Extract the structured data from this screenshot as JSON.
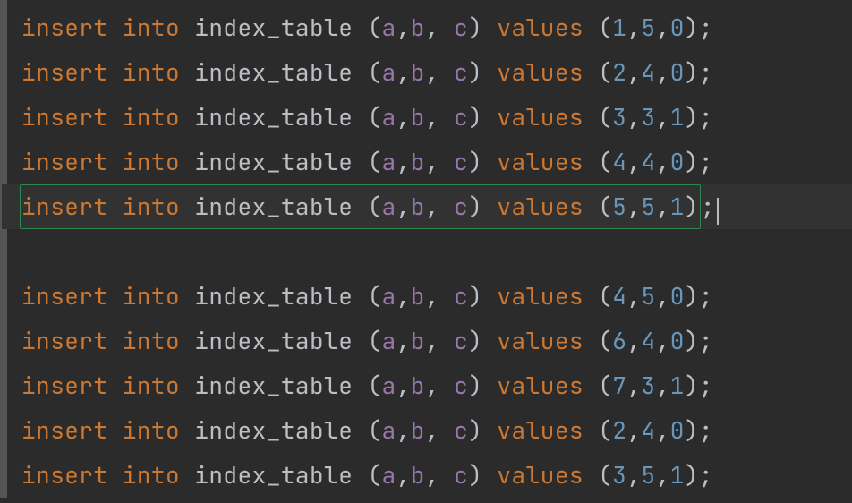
{
  "code": {
    "keyword_insert": "insert",
    "keyword_into": "into",
    "table_name": "index_table",
    "col_a": "a",
    "col_b": "b",
    "col_c": "c",
    "keyword_values": "values",
    "paren_open": "(",
    "paren_close": ")",
    "comma": ",",
    "comma_sp": ", ",
    "semicolon": ";",
    "space": " "
  },
  "rows": [
    {
      "v1": "1",
      "v2": "5",
      "v3": "0",
      "current": false
    },
    {
      "v1": "2",
      "v2": "4",
      "v3": "0",
      "current": false
    },
    {
      "v1": "3",
      "v2": "3",
      "v3": "1",
      "current": false
    },
    {
      "v1": "4",
      "v2": "4",
      "v3": "0",
      "current": false
    },
    {
      "v1": "5",
      "v2": "5",
      "v3": "1",
      "current": true
    },
    {
      "blank": true
    },
    {
      "v1": "4",
      "v2": "5",
      "v3": "0",
      "current": false
    },
    {
      "v1": "6",
      "v2": "4",
      "v3": "0",
      "current": false
    },
    {
      "v1": "7",
      "v2": "3",
      "v3": "1",
      "current": false
    },
    {
      "v1": "2",
      "v2": "4",
      "v3": "0",
      "current": false
    },
    {
      "v1": "3",
      "v2": "5",
      "v3": "1",
      "current": false
    }
  ],
  "colors": {
    "background": "#2b2b2b",
    "current_line_bg": "#323232",
    "keyword": "#cc7832",
    "identifier": "#bcbec4",
    "column": "#9876aa",
    "number": "#6897bb",
    "selection_border": "#2d8a4e"
  }
}
